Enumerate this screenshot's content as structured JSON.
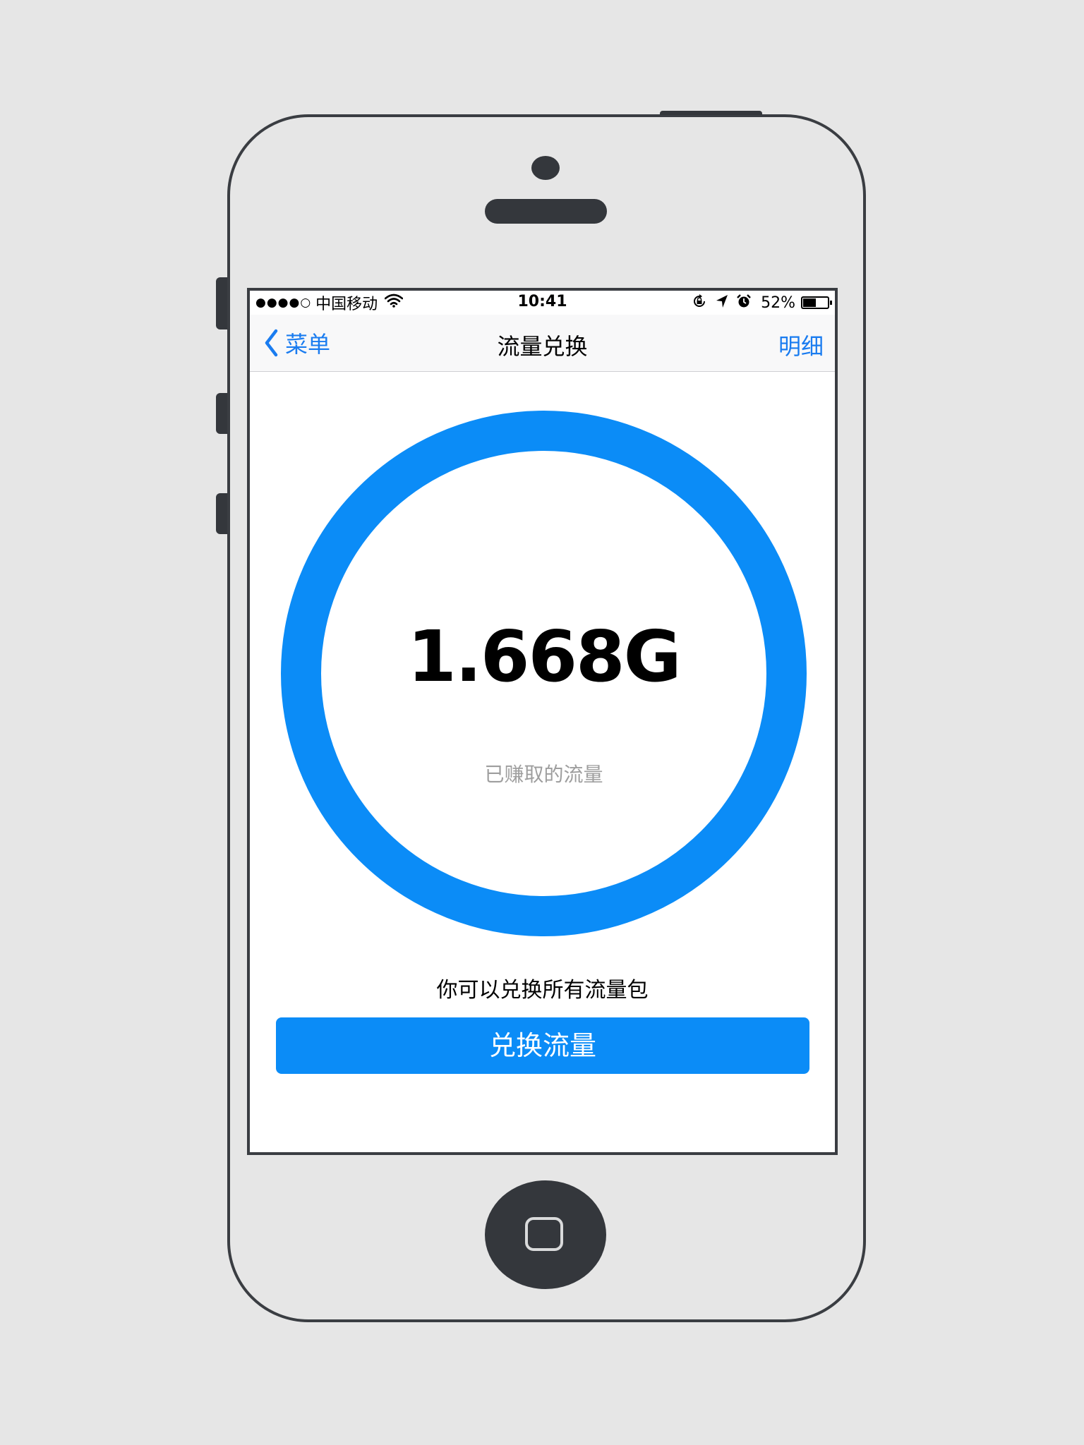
{
  "status_bar": {
    "signal": "●●●●○",
    "carrier": "中国移动",
    "time": "10:41",
    "battery_percent": "52%",
    "battery_level": 0.52,
    "icons": [
      "wifi-icon",
      "rotation-lock-icon",
      "location-arrow-icon",
      "alarm-clock-icon",
      "battery-icon"
    ]
  },
  "nav": {
    "back_label": "菜单",
    "title": "流量兑换",
    "right_label": "明细"
  },
  "summary": {
    "amount": "1.668G",
    "caption": "已赚取的流量"
  },
  "exchange": {
    "hint": "你可以兑换所有流量包",
    "button_label": "兑换流量"
  },
  "colors": {
    "accent": "#1a7cf0",
    "ring": "#0b8cf7",
    "button": "#0b8cf7",
    "frame": "#3a3d42",
    "background": "#e6e6e6"
  }
}
